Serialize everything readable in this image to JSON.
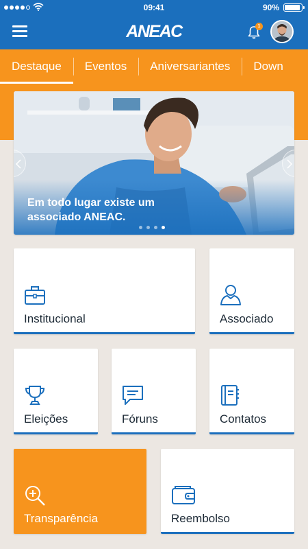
{
  "status": {
    "time": "09:41",
    "battery": "90%",
    "battery_level": 0.9
  },
  "header": {
    "logo": "ANEAC",
    "notification_count": "1"
  },
  "tabs": [
    {
      "label": "Destaque"
    },
    {
      "label": "Eventos"
    },
    {
      "label": "Aniversariantes"
    },
    {
      "label": "Down"
    }
  ],
  "banner": {
    "caption": "Em todo lugar existe um associado ANEAC.",
    "slides": 4,
    "active_slide": 4
  },
  "menu": {
    "institucional": "Institucional",
    "associado": "Associado",
    "eleicoes": "Eleições",
    "foruns": "Fóruns",
    "contatos": "Contatos",
    "transparencia": "Transparência",
    "reembolso": "Reembolso"
  },
  "colors": {
    "primary": "#1b6fbd",
    "accent": "#f7941d",
    "background": "#ece7e2"
  },
  "icons": {
    "menu": "hamburger-icon",
    "notifications": "bell-icon",
    "institucional": "briefcase-icon",
    "associado": "person-icon",
    "eleicoes": "trophy-icon",
    "foruns": "chat-bubble-icon",
    "contatos": "address-book-icon",
    "transparencia": "magnifier-plus-icon",
    "reembolso": "wallet-icon"
  }
}
